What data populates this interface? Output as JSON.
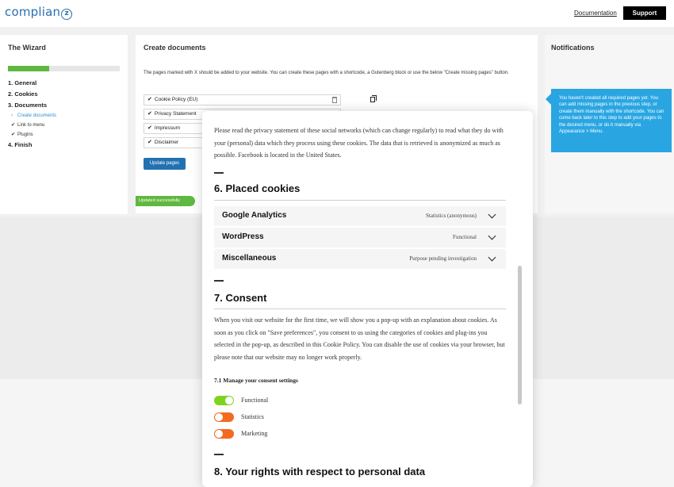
{
  "header": {
    "logo_text": "complian",
    "logo_mark": "z",
    "documentation_link": "Documentation",
    "support_button": "Support"
  },
  "wizard": {
    "title": "The Wizard",
    "progress": 0.37,
    "steps": [
      {
        "label": "1. General"
      },
      {
        "label": "2. Cookies"
      },
      {
        "label": "3. Documents"
      }
    ],
    "substeps": [
      {
        "label": "Create documents",
        "icon": "chevron-right-icon"
      },
      {
        "label": "Link to menu",
        "icon": "check-icon"
      },
      {
        "label": "Plugins",
        "icon": "check-icon"
      }
    ],
    "finish_step": "4. Finish"
  },
  "create_documents": {
    "title": "Create documents",
    "description": "The pages marked with X should be added to your website. You can create these pages with a shortcode, a Gutenberg block or use the below \"Create missing pages\" button.",
    "pages": [
      {
        "label": "Cookie Policy (EU)"
      },
      {
        "label": "Privacy Statement"
      },
      {
        "label": "Impressum"
      },
      {
        "label": "Disclaimer"
      }
    ],
    "update_button": "Update pages",
    "toast": "Updated successfully"
  },
  "notifications": {
    "title": "Notifications",
    "message": "You haven't created all required pages yet. You can add missing pages in the previous step, or create them manually with the shortcode. You can come back later to this step to add your pages to the desired menu, or do it manually via Appearance > Menu."
  },
  "document_preview": {
    "intro_text": "Please read the privacy statement of these social networks (which can change regularly) to read what they do with your (personal) data which they process using these cookies. The data that is retrieved is anonymized as much as possible. Facebook is located in the United States.",
    "section6_title": "6. Placed cookies",
    "cookies": [
      {
        "name": "Google Analytics",
        "purpose": "Statistics (anonymous)"
      },
      {
        "name": "WordPress",
        "purpose": "Functional"
      },
      {
        "name": "Miscellaneous",
        "purpose": "Purpose pending investigation"
      }
    ],
    "section7_title": "7. Consent",
    "consent_text": "When you visit our website for the first time, we will show you a pop-up with an explanation about cookies. As soon as you click on \"Save preferences\", you consent to us using the categories of cookies and plug-ins you selected in the pop-up, as described in this Cookie Policy. You can disable the use of cookies via your browser, but please note that our website may no longer work properly.",
    "manage_title": "7.1 Manage your consent settings",
    "toggles": [
      {
        "label": "Functional",
        "on": true,
        "color": "#7ed321"
      },
      {
        "label": "Statistics",
        "on": false,
        "color": "#f36a21"
      },
      {
        "label": "Marketing",
        "on": false,
        "color": "#f36a21"
      }
    ],
    "section8_title": "8. Your rights with respect to personal data"
  }
}
